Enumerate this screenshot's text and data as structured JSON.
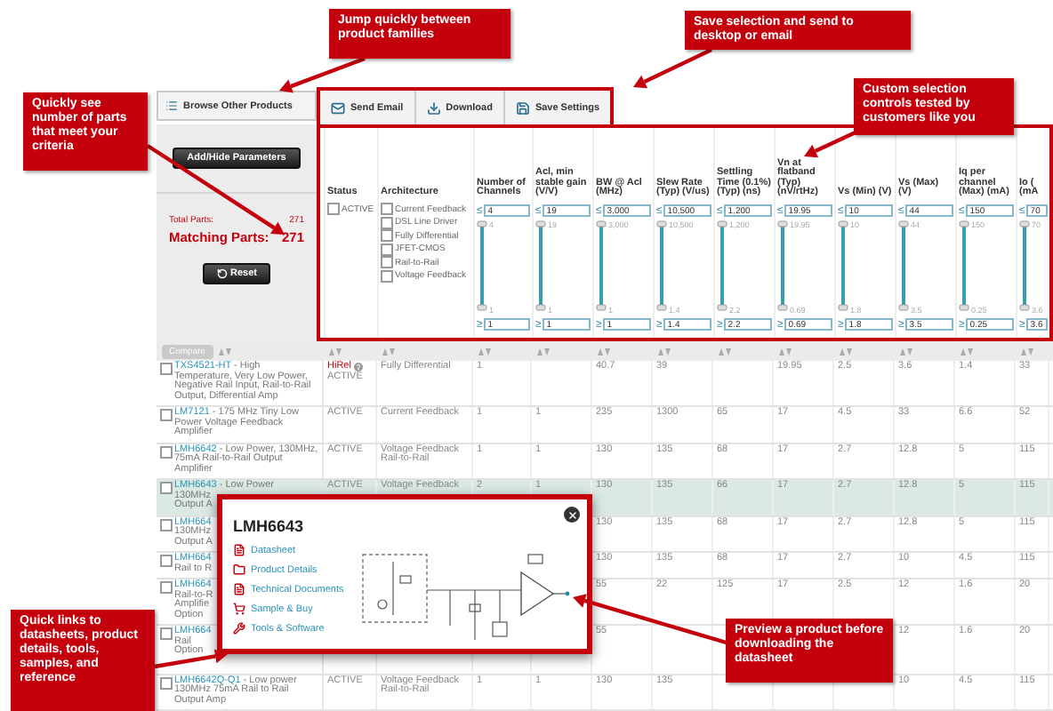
{
  "callouts": [
    {
      "text": "Jump quickly between product families"
    },
    {
      "text": "Save selection and send to desktop or email"
    },
    {
      "text": "Quickly see number of parts that meet your criteria"
    },
    {
      "text": "Custom selection controls tested by customers like you"
    },
    {
      "text": "Quick links to datasheets, product details, tools, samples, and reference"
    },
    {
      "text": "Preview a product before downloading the datasheet"
    }
  ],
  "sidebar": {
    "browse_button": "Browse Other Products",
    "parameters_button": "Add/Hide Parameters",
    "total_label": "Total Parts:",
    "total_value": "271",
    "matching_label": "Matching Parts:",
    "matching_value": "271",
    "reset_button": "Reset"
  },
  "toolbar": [
    {
      "label": "Send Email",
      "kind": "email"
    },
    {
      "label": "Download",
      "kind": "download"
    },
    {
      "label": "Save Settings",
      "kind": "save"
    }
  ],
  "filters": {
    "status": {
      "header": "Status",
      "options": [
        {
          "label": "ACTIVE",
          "checked": false
        }
      ]
    },
    "architecture": {
      "header": "Architecture",
      "options": [
        {
          "label": "Current Feedback",
          "checked": false
        },
        {
          "label": "DSL Line Driver",
          "checked": false
        },
        {
          "label": "Fully Differential",
          "checked": false
        },
        {
          "label": "JFET-CMOS",
          "checked": false
        },
        {
          "label": "Rail-to-Rail",
          "checked": false
        },
        {
          "label": "Voltage Feedback",
          "checked": false
        }
      ]
    },
    "ranges": [
      {
        "header": "Number of Channels",
        "level": 1,
        "max_op": "≤",
        "max": "4",
        "max_label": "4",
        "min_label": "1",
        "min_op": "≥",
        "min": "1"
      },
      {
        "header": "Acl, min stable gain (V/V)",
        "level": 1,
        "max_op": "≤",
        "max": "19",
        "max_label": "19",
        "min_label": "1",
        "min_op": "≥",
        "min": "1"
      },
      {
        "header": "BW @ Acl (MHz)",
        "level": 1,
        "max_op": "≤",
        "max": "3,000",
        "max_label": "3,000",
        "min_label": "1",
        "min_op": "≥",
        "min": "1"
      },
      {
        "header": "Slew Rate (Typ) (V/us)",
        "level": 1,
        "max_op": "≤",
        "max": "10,500",
        "max_label": "10,500",
        "min_label": "1.4",
        "min_op": "≥",
        "min": "1.4"
      },
      {
        "header": "Settling Time (0.1%) (Typ) (ns)",
        "level": 1,
        "max_op": "≤",
        "max": "1,200",
        "max_label": "1,200",
        "min_label": "2.2",
        "min_op": "≥",
        "min": "2.2"
      },
      {
        "header": "Vn at flatband (Typ) (nV/rtHz)",
        "level": 1,
        "max_op": "≤",
        "max": "19.95",
        "max_label": "19.95",
        "min_label": "0.69",
        "min_op": "≥",
        "min": "0.69"
      },
      {
        "header": "Vs (Min) (V)",
        "level": 1,
        "max_op": "≤",
        "max": "10",
        "max_label": "10",
        "min_label": "1.8",
        "min_op": "≥",
        "min": "1.8"
      },
      {
        "header": "Vs (Max) (V)",
        "level": 1,
        "max_op": "≤",
        "max": "44",
        "max_label": "44",
        "min_label": "3.5",
        "min_op": "≥",
        "min": "3.5"
      },
      {
        "header": "Iq per channel (Max) (mA)",
        "level": 1,
        "max_op": "≤",
        "max": "150",
        "max_label": "150",
        "min_label": "0.25",
        "min_op": "≥",
        "min": "0.25"
      },
      {
        "header": "Io ( (mA",
        "level": 1,
        "max_op": "≤",
        "max": "70",
        "max_label": "70",
        "min_label": "3.6",
        "min_op": "≥",
        "min": "3.6"
      }
    ]
  },
  "table": {
    "compare_button": "Compare",
    "rows": [
      {
        "checked": false,
        "selected": false,
        "part": "TXS4521-HT",
        "description": "- High Temperature, Very Low Power, Negative Rail Input, Rail-to-Rail Output, Differential Amp",
        "badge": "HiRel",
        "status": "ACTIVE",
        "architecture": "Fully Differential",
        "channels": "1",
        "bw": "40.7",
        "slew": "39",
        "vn": "19.95",
        "vs_min": "2.5",
        "vs_max": "3.6",
        "iq": "1.4",
        "io": "33"
      },
      {
        "checked": false,
        "selected": false,
        "part": "LM7121",
        "description": "- 175 MHz Tiny Low Power Voltage Feedback Amplifier",
        "status": "ACTIVE",
        "architecture": "Current Feedback",
        "channels": "1",
        "acl": "1",
        "bw": "235",
        "slew": "1300",
        "settling": "65",
        "vn": "17",
        "vs_min": "4.5",
        "vs_max": "33",
        "iq": "6.6",
        "io": "52"
      },
      {
        "checked": false,
        "selected": false,
        "part": "LMH6642",
        "description": "- Low Power, 130MHz, 75mA Rail-to-Rail Output Amplifier",
        "status": "ACTIVE",
        "architecture": "Voltage Feedback Rail-to-Rail",
        "channels": "1",
        "acl": "1",
        "bw": "130",
        "slew": "135",
        "settling": "68",
        "vn": "17",
        "vs_min": "2.7",
        "vs_max": "12.8",
        "iq": "5",
        "io": "115"
      },
      {
        "checked": false,
        "selected": true,
        "part": "LMH6643",
        "description": "- Low Power",
        "lines": [
          "130MHz",
          "Output A"
        ],
        "status": "ACTIVE",
        "architecture": "Voltage Feedback",
        "channels": "2",
        "acl": "1",
        "bw": "130",
        "slew": "135",
        "settling": "66",
        "vn": "17",
        "vs_min": "2.7",
        "vs_max": "12.8",
        "iq": "5",
        "io": "115"
      },
      {
        "checked": false,
        "selected": false,
        "part": "LMH664",
        "lines": [
          "130MHz",
          "Output A"
        ],
        "bw": "130",
        "slew": "135",
        "settling": "68",
        "vn": "17",
        "vs_min": "2.7",
        "vs_max": "12.8",
        "iq": "5",
        "io": "115"
      },
      {
        "checked": false,
        "selected": false,
        "part": "LMH664",
        "lines": [
          "Rail to R"
        ],
        "bw": "130",
        "slew": "135",
        "settling": "68",
        "vn": "17",
        "vs_min": "2.7",
        "vs_max": "10",
        "iq": "4.5",
        "io": "115"
      },
      {
        "checked": false,
        "selected": false,
        "part": "LMH664",
        "lines": [
          "Rail-to-R",
          "Amplifie",
          "Option"
        ],
        "bw": "55",
        "slew": "22",
        "settling": "125",
        "vn": "17",
        "vs_min": "2.5",
        "vs_max": "12",
        "iq": "1.6",
        "io": "20"
      },
      {
        "checked": false,
        "selected": false,
        "part": "LMH664",
        "lines": [
          "Rail",
          "Option"
        ],
        "bw": "55",
        "vs_max": "12",
        "iq": "1.6",
        "io": "20"
      },
      {
        "checked": false,
        "selected": false,
        "part": "LMH6642Q-Q1",
        "description": "- Low power 130MHz 75mA Rail to Rail Output Amp",
        "status": "ACTIVE",
        "architecture": "Voltage Feedback Rail-to-Rail",
        "channels": "1",
        "acl": "1",
        "bw": "130",
        "slew": "135",
        "vs_max": "10",
        "iq": "4.5",
        "io": "115"
      }
    ]
  },
  "popup": {
    "title": "LMH6643",
    "links": [
      {
        "label": "Datasheet",
        "kind": "pdf"
      },
      {
        "label": "Product Details",
        "kind": "folder"
      },
      {
        "label": "Technical Documents",
        "kind": "pdf"
      },
      {
        "label": "Sample & Buy",
        "kind": "cart"
      },
      {
        "label": "Tools & Software",
        "kind": "tools"
      }
    ]
  }
}
